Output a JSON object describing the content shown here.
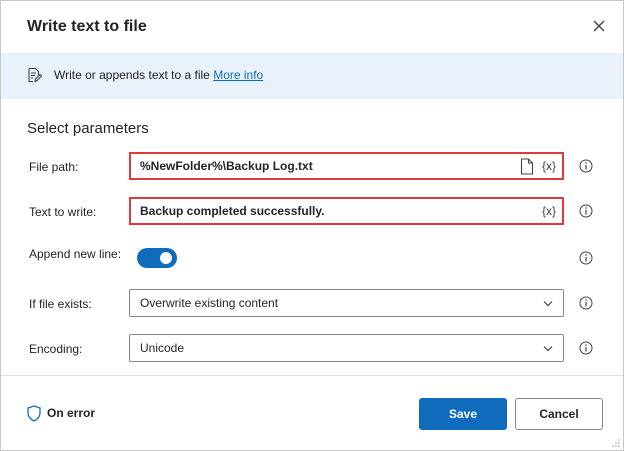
{
  "dialog": {
    "title": "Write text to file",
    "close_icon": "close-icon"
  },
  "info": {
    "text": "Write or appends text to a file",
    "link": "More info",
    "icon": "edit-document-icon"
  },
  "section_title": "Select parameters",
  "fields": {
    "file_path": {
      "label": "File path:",
      "value": "%NewFolder%\\Backup Log.txt",
      "var_button": "{x}",
      "file_icon": "file-icon",
      "highlighted": true
    },
    "text_to_write": {
      "label": "Text to write:",
      "value": "Backup completed successfully.",
      "var_button": "{x}",
      "highlighted": true
    },
    "append_new_line": {
      "label": "Append new line:",
      "enabled": true
    },
    "if_file_exists": {
      "label": "If file exists:",
      "selected": "Overwrite existing content"
    },
    "encoding": {
      "label": "Encoding:",
      "selected": "Unicode"
    }
  },
  "footer": {
    "on_error": "On error",
    "save": "Save",
    "cancel": "Cancel"
  },
  "colors": {
    "accent": "#0f6cbd",
    "highlight_border": "#e0393e",
    "info_bar": "#e9f1fb"
  }
}
